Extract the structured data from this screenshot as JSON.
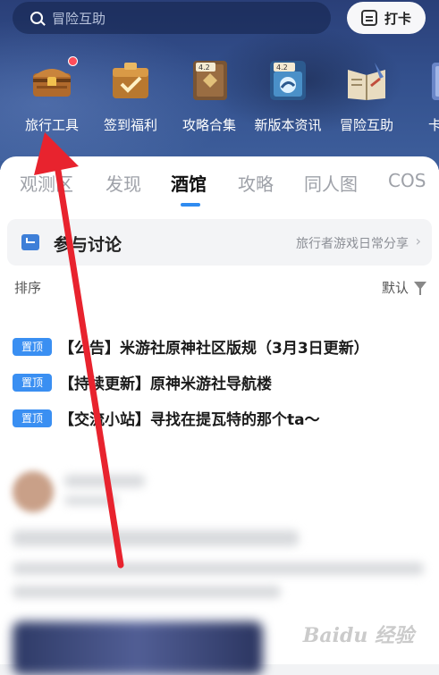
{
  "search": {
    "placeholder": "冒险互助",
    "icon": "search-icon"
  },
  "checkin": {
    "label": "打卡",
    "icon": "checkin-icon"
  },
  "tools": [
    {
      "label": "旅行工具",
      "icon": "treasure-chest-icon",
      "has_dot": true
    },
    {
      "label": "签到福利",
      "icon": "gift-box-icon"
    },
    {
      "label": "攻略合集",
      "icon": "guide-book-icon",
      "badge": "4.2 版本"
    },
    {
      "label": "新版本资讯",
      "icon": "news-book-icon",
      "badge": "4.2 版本"
    },
    {
      "label": "冒险互助",
      "icon": "scroll-book-icon"
    },
    {
      "label": "卡牌",
      "icon": "card-icon"
    }
  ],
  "tabs": [
    {
      "label": "观测区"
    },
    {
      "label": "发现"
    },
    {
      "label": "酒馆",
      "active": true
    },
    {
      "label": "攻略"
    },
    {
      "label": "同人图"
    },
    {
      "label": "COS"
    }
  ],
  "forum": {
    "title": "参与讨论",
    "subtitle": "旅行者游戏日常分享",
    "chevron": "›"
  },
  "sort": {
    "label": "排序",
    "value": "默认"
  },
  "pinned": [
    {
      "badge": "置顶",
      "text": "【公告】米游社原神社区版规（3月3日更新）"
    },
    {
      "badge": "置顶",
      "text": "【持续更新】原神米游社导航楼"
    },
    {
      "badge": "置顶",
      "text": "【交流小站】寻找在提瓦特的那个ta～"
    }
  ],
  "watermark": "Baidu 经验",
  "colors": {
    "accent": "#2f8bf0",
    "badge": "#3a8ff2",
    "arrow": "#e8232e",
    "header": "#33508d"
  }
}
